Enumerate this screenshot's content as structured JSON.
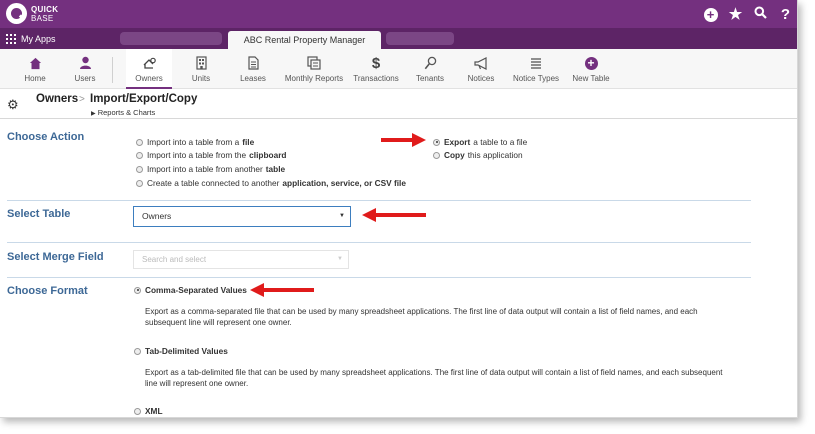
{
  "brand": {
    "logo_line1": "QUICK",
    "logo_line2": "BASE",
    "accent": "#74307f",
    "section_color": "#3d6896",
    "arrow_color": "#e01b1b"
  },
  "top_icons": [
    "plus-icon",
    "star-icon",
    "search-icon",
    "help-icon"
  ],
  "help_label": "?",
  "appbar": {
    "my_apps": "My Apps",
    "active_app": "ABC Rental Property Manager"
  },
  "nav": [
    {
      "label": "Home",
      "icon": "home-icon"
    },
    {
      "label": "Users",
      "icon": "users-icon"
    },
    {
      "label": "Owners",
      "icon": "owners-icon",
      "active": true
    },
    {
      "label": "Units",
      "icon": "units-icon"
    },
    {
      "label": "Leases",
      "icon": "leases-icon"
    },
    {
      "label": "Monthly Reports",
      "icon": "monthly-reports-icon"
    },
    {
      "label": "Transactions",
      "icon": "transactions-icon"
    },
    {
      "label": "Tenants",
      "icon": "tenants-icon"
    },
    {
      "label": "Notices",
      "icon": "notices-icon"
    },
    {
      "label": "Notice Types",
      "icon": "notice-types-icon"
    },
    {
      "label": "New Table",
      "icon": "new-table-icon"
    }
  ],
  "breadcrumb": {
    "table": "Owners",
    "separator": ">",
    "page": "Import/Export/Copy",
    "reports_link": "Reports & Charts"
  },
  "choose_action": {
    "label": "Choose Action",
    "options": [
      {
        "text": "Import into a table from a",
        "bold": "file",
        "selected": false
      },
      {
        "text": "Import into a table from the",
        "bold": "clipboard",
        "selected": false
      },
      {
        "text": "Import into a table from another",
        "bold": "table",
        "selected": false
      },
      {
        "text": "Create a table connected to another",
        "bold": "application, service, or CSV file",
        "selected": false
      },
      {
        "pre": "Export",
        "text": "a table to a file",
        "selected": true
      },
      {
        "pre": "Copy",
        "text": "this application",
        "selected": false
      }
    ]
  },
  "select_table": {
    "label": "Select Table",
    "value": "Owners"
  },
  "select_merge_field": {
    "label": "Select Merge Field",
    "placeholder": "Search and select"
  },
  "choose_format": {
    "label": "Choose Format",
    "options": [
      {
        "name": "Comma-Separated Values",
        "selected": true,
        "description": "Export as a comma-separated file that can be used by many spreadsheet applications. The first line of data output will contain a list of field names, and each subsequent line will represent one owner."
      },
      {
        "name": "Tab-Delimited Values",
        "selected": false,
        "description": "Export as a tab-delimited file that can be used by many spreadsheet applications. The first line of data output will contain a list of field names, and each subsequent line will represent one owner."
      },
      {
        "name": "XML",
        "selected": false,
        "description": ""
      }
    ]
  }
}
